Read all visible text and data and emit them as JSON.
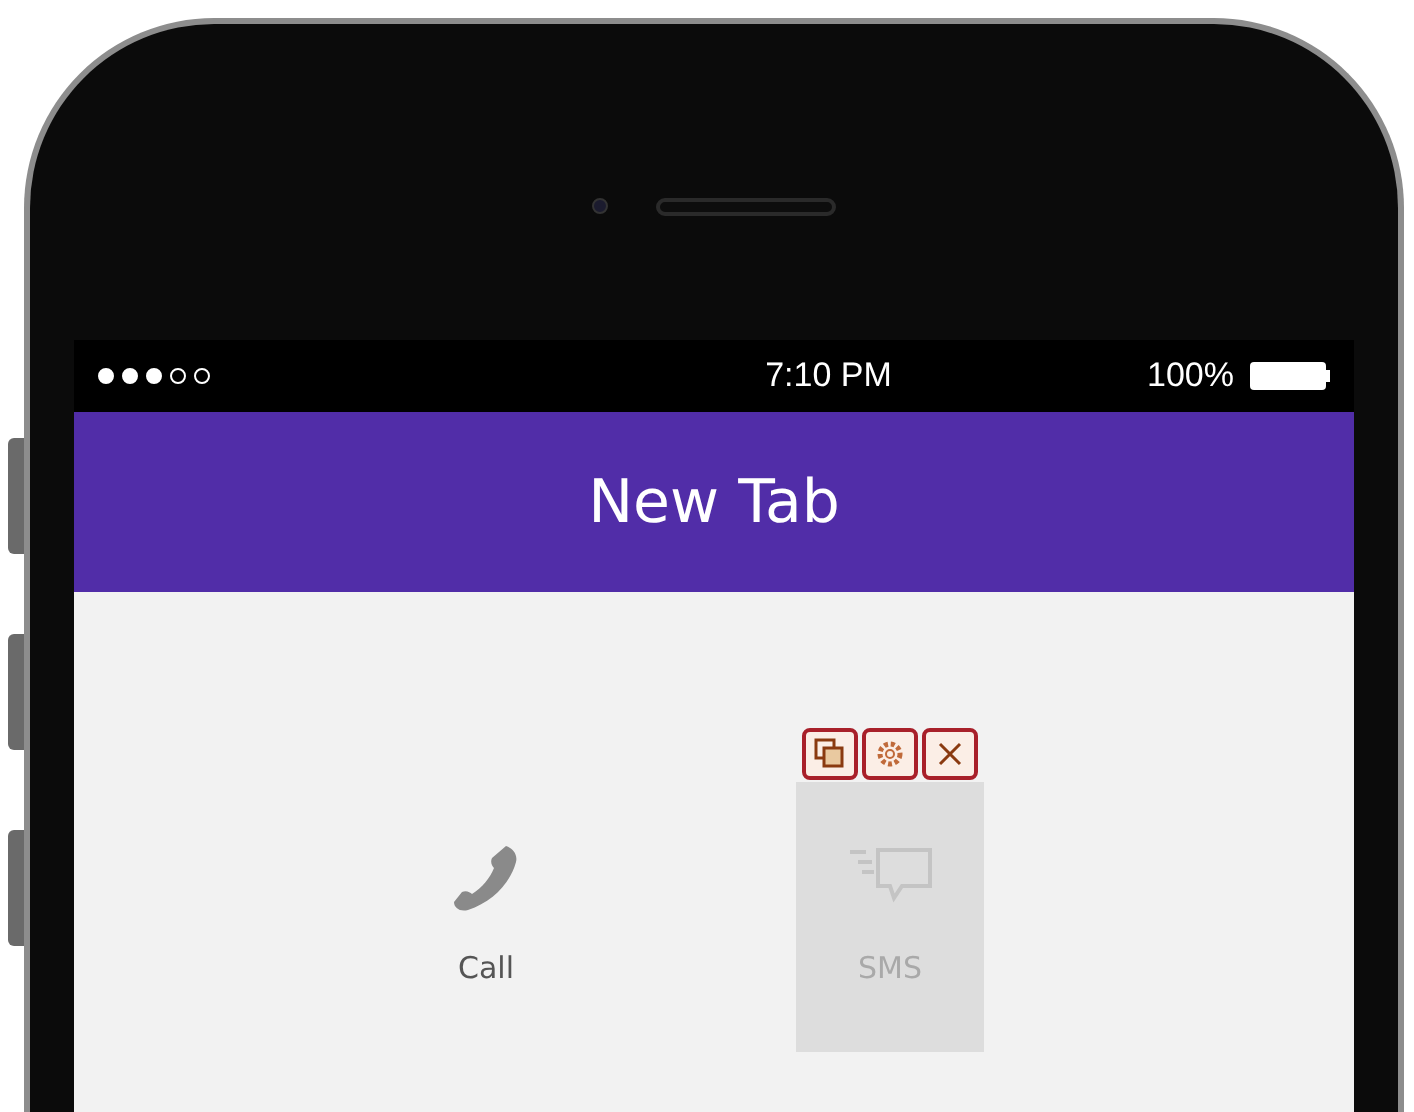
{
  "status_bar": {
    "time": "7:10 PM",
    "battery": "100%"
  },
  "header": {
    "title": "New Tab"
  },
  "tiles": [
    {
      "kind": "call",
      "label": "Call",
      "selected": false
    },
    {
      "kind": "sms",
      "label": "SMS",
      "selected": true
    }
  ]
}
